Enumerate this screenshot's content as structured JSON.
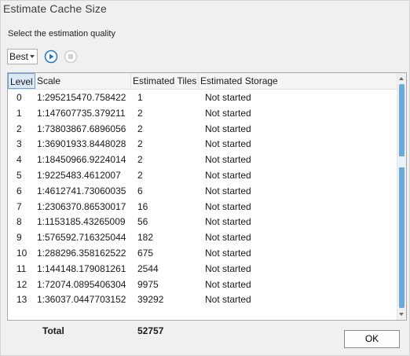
{
  "dialog": {
    "title": "Estimate Cache Size"
  },
  "quality": {
    "label": "Select the estimation quality",
    "selected": "Best"
  },
  "toolbar": {
    "play_icon": "play-icon",
    "stop_icon": "stop-icon",
    "accent_color": "#1e78c8"
  },
  "grid": {
    "columns": [
      "Level",
      "Scale",
      "Estimated Tiles",
      "Estimated Storage"
    ],
    "rows": [
      {
        "level": "0",
        "scale": "1:295215470.758422",
        "tiles": "1",
        "storage": "Not started"
      },
      {
        "level": "1",
        "scale": "1:147607735.379211",
        "tiles": "2",
        "storage": "Not started"
      },
      {
        "level": "2",
        "scale": "1:73803867.6896056",
        "tiles": "2",
        "storage": "Not started"
      },
      {
        "level": "3",
        "scale": "1:36901933.8448028",
        "tiles": "2",
        "storage": "Not started"
      },
      {
        "level": "4",
        "scale": "1:18450966.9224014",
        "tiles": "2",
        "storage": "Not started"
      },
      {
        "level": "5",
        "scale": "1:9225483.4612007",
        "tiles": "2",
        "storage": "Not started"
      },
      {
        "level": "6",
        "scale": "1:4612741.73060035",
        "tiles": "6",
        "storage": "Not started"
      },
      {
        "level": "7",
        "scale": "1:2306370.86530017",
        "tiles": "16",
        "storage": "Not started"
      },
      {
        "level": "8",
        "scale": "1:1153185.43265009",
        "tiles": "56",
        "storage": "Not started"
      },
      {
        "level": "9",
        "scale": "1:576592.716325044",
        "tiles": "182",
        "storage": "Not started"
      },
      {
        "level": "10",
        "scale": "1:288296.358162522",
        "tiles": "675",
        "storage": "Not started"
      },
      {
        "level": "11",
        "scale": "1:144148.179081261",
        "tiles": "2544",
        "storage": "Not started"
      },
      {
        "level": "12",
        "scale": "1:72074.0895406304",
        "tiles": "9975",
        "storage": "Not started"
      },
      {
        "level": "13",
        "scale": "1:36037.0447703152",
        "tiles": "39292",
        "storage": "Not started"
      }
    ]
  },
  "total": {
    "label": "Total",
    "tiles": "52757"
  },
  "actions": {
    "ok_label": "OK"
  }
}
